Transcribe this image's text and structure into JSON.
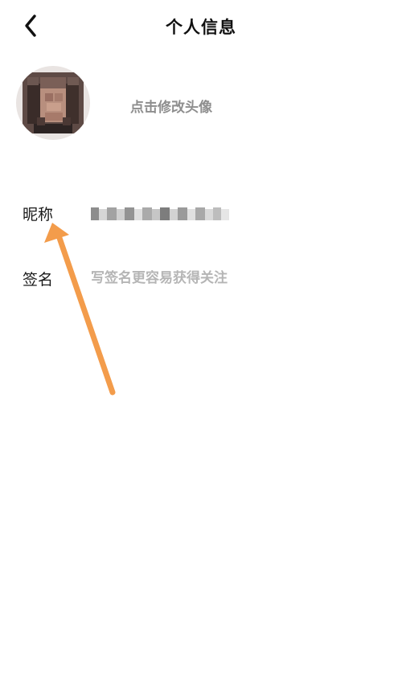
{
  "header": {
    "title": "个人信息",
    "back_icon": "chevron-left-icon"
  },
  "avatar": {
    "hint": "点击修改头像"
  },
  "fields": {
    "nickname": {
      "label": "昵称",
      "value_note": "pixelated (hidden) nickname"
    },
    "signature": {
      "label": "签名",
      "placeholder": "写签名更容易获得关注"
    }
  },
  "annotation": {
    "type": "arrow",
    "color": "#f39c4b",
    "points_to": "nickname-label"
  },
  "colors": {
    "background": "#ffffff",
    "text": "#111111",
    "hint": "#8e8e8e",
    "placeholder": "#b5b5b5",
    "arrow": "#f39c4b"
  }
}
